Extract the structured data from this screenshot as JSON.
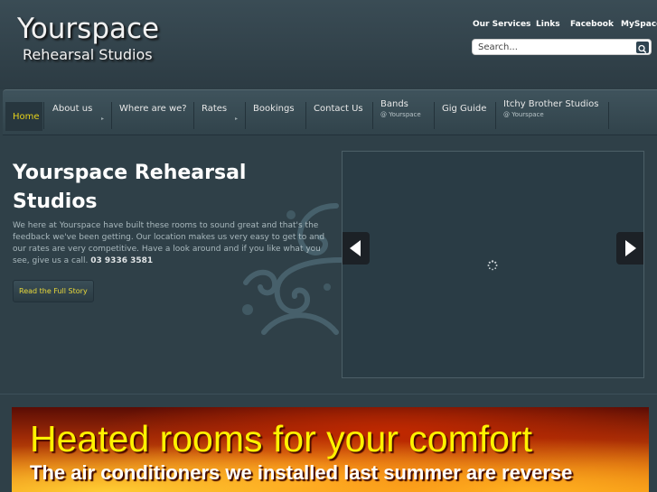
{
  "logo": {
    "title": "Yourspace",
    "subtitle": "Rehearsal Studios"
  },
  "top_links": [
    "Our Services",
    "Links",
    "Facebook",
    "MySpace"
  ],
  "search": {
    "placeholder": "Search..."
  },
  "nav": {
    "items": [
      {
        "label": "Home",
        "sub": "",
        "has_arrow": false,
        "active": true
      },
      {
        "label": "About us",
        "sub": "",
        "has_arrow": true
      },
      {
        "label": "Where are we?",
        "sub": "",
        "has_arrow": false
      },
      {
        "label": "Rates",
        "sub": "",
        "has_arrow": true
      },
      {
        "label": "Bookings",
        "sub": "",
        "has_arrow": false
      },
      {
        "label": "Contact Us",
        "sub": "",
        "has_arrow": false
      },
      {
        "label": "Bands",
        "sub": "@ Yourspace",
        "has_arrow": false
      },
      {
        "label": "Gig Guide",
        "sub": "",
        "has_arrow": false
      },
      {
        "label": "Itchy Brother Studios",
        "sub": "@ Yourspace",
        "has_arrow": false
      }
    ],
    "active_color": "#e6d21a"
  },
  "hero": {
    "title": "Yourspace Rehearsal Studios",
    "text": "We here at Yourspace have built these rooms to sound great and that's the feedback we've been getting. Our location makes us very easy to get to and our rates are very competitive. Have a look around and if you like what you see, give us a call.",
    "phone": "03 9336 3581",
    "button": "Read the Full Story"
  },
  "slider": {
    "prev_icon": "triangle-left-icon",
    "next_icon": "triangle-right-icon",
    "loader_icon": "spinner-icon"
  },
  "banner": {
    "title": "Heated rooms for your comfort",
    "text": "The air conditioners we installed last summer are reverse"
  }
}
